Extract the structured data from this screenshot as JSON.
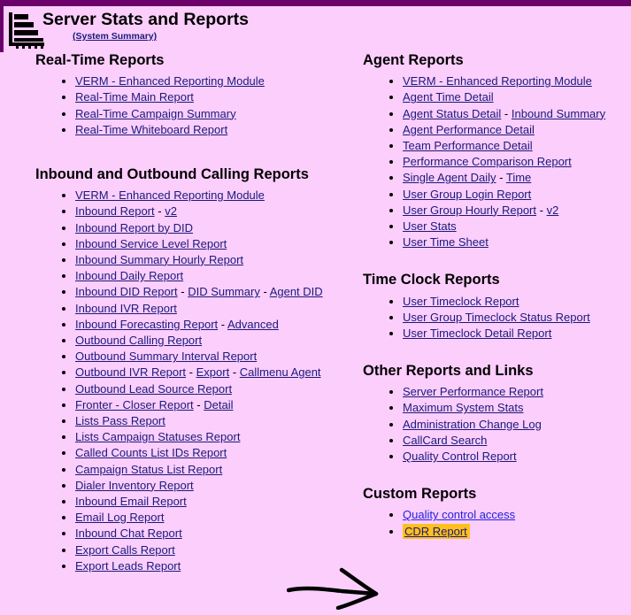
{
  "theme": {
    "page_bg": "#FCCEFC",
    "accent_bar": "#6B006B",
    "link_visited": "#1A1A7A",
    "link_unvisited": "#2222DD",
    "highlight": "#FFC01F",
    "text": "#000000"
  },
  "header": {
    "title": "Server Stats and Reports",
    "subtitle": "(System Summary)",
    "logo_icon": "bar-chart-icon"
  },
  "left_column": [
    {
      "heading": "Real-Time Reports",
      "items": [
        {
          "links": [
            {
              "label": "VERM - Enhanced Reporting Module",
              "state": "visited"
            }
          ]
        },
        {
          "links": [
            {
              "label": "Real-Time Main Report",
              "state": "visited"
            }
          ]
        },
        {
          "links": [
            {
              "label": "Real-Time Campaign Summary",
              "state": "visited"
            }
          ]
        },
        {
          "links": [
            {
              "label": "Real-Time Whiteboard Report",
              "state": "visited"
            }
          ]
        }
      ]
    },
    {
      "heading": "Inbound and Outbound Calling Reports",
      "items": [
        {
          "links": [
            {
              "label": "VERM - Enhanced Reporting Module",
              "state": "visited"
            }
          ]
        },
        {
          "links": [
            {
              "label": "Inbound Report",
              "state": "visited"
            },
            {
              "label": "v2",
              "state": "visited"
            }
          ]
        },
        {
          "links": [
            {
              "label": "Inbound Report by DID",
              "state": "visited"
            }
          ]
        },
        {
          "links": [
            {
              "label": "Inbound Service Level Report",
              "state": "visited"
            }
          ]
        },
        {
          "links": [
            {
              "label": "Inbound Summary Hourly Report",
              "state": "visited"
            }
          ]
        },
        {
          "links": [
            {
              "label": "Inbound Daily Report",
              "state": "visited"
            }
          ]
        },
        {
          "links": [
            {
              "label": "Inbound DID Report",
              "state": "visited"
            },
            {
              "label": "DID Summary",
              "state": "visited"
            },
            {
              "label": "Agent DID",
              "state": "visited"
            }
          ]
        },
        {
          "links": [
            {
              "label": "Inbound IVR Report",
              "state": "visited"
            }
          ]
        },
        {
          "links": [
            {
              "label": "Inbound Forecasting Report",
              "state": "visited"
            },
            {
              "label": "Advanced",
              "state": "visited"
            }
          ]
        },
        {
          "links": [
            {
              "label": "Outbound Calling Report",
              "state": "visited"
            }
          ]
        },
        {
          "links": [
            {
              "label": "Outbound Summary Interval Report",
              "state": "visited"
            }
          ]
        },
        {
          "links": [
            {
              "label": "Outbound IVR Report",
              "state": "visited"
            },
            {
              "label": "Export",
              "state": "visited"
            },
            {
              "label": "Callmenu Agent",
              "state": "visited"
            }
          ]
        },
        {
          "links": [
            {
              "label": "Outbound Lead Source Report",
              "state": "visited"
            }
          ]
        },
        {
          "links": [
            {
              "label": "Fronter - Closer Report",
              "state": "visited"
            },
            {
              "label": "Detail",
              "state": "visited"
            }
          ]
        },
        {
          "links": [
            {
              "label": "Lists Pass Report",
              "state": "visited"
            }
          ]
        },
        {
          "links": [
            {
              "label": "Lists Campaign Statuses Report",
              "state": "visited"
            }
          ]
        },
        {
          "links": [
            {
              "label": "Called Counts List IDs Report",
              "state": "visited"
            }
          ]
        },
        {
          "links": [
            {
              "label": "Campaign Status List Report",
              "state": "visited"
            }
          ]
        },
        {
          "links": [
            {
              "label": "Dialer Inventory Report",
              "state": "visited"
            }
          ]
        },
        {
          "links": [
            {
              "label": "Inbound Email Report",
              "state": "visited"
            }
          ]
        },
        {
          "links": [
            {
              "label": "Email Log Report",
              "state": "visited"
            }
          ]
        },
        {
          "links": [
            {
              "label": "Inbound Chat Report",
              "state": "visited"
            }
          ]
        },
        {
          "links": [
            {
              "label": "Export Calls Report",
              "state": "visited"
            }
          ]
        },
        {
          "links": [
            {
              "label": "Export Leads Report",
              "state": "visited"
            }
          ]
        }
      ]
    }
  ],
  "right_column": [
    {
      "heading": "Agent Reports",
      "items": [
        {
          "links": [
            {
              "label": "VERM - Enhanced Reporting Module",
              "state": "visited"
            }
          ]
        },
        {
          "links": [
            {
              "label": "Agent Time Detail",
              "state": "visited"
            }
          ]
        },
        {
          "links": [
            {
              "label": "Agent Status Detail",
              "state": "visited"
            },
            {
              "label": "Inbound Summary",
              "state": "visited"
            }
          ]
        },
        {
          "links": [
            {
              "label": "Agent Performance Detail",
              "state": "visited"
            }
          ]
        },
        {
          "links": [
            {
              "label": "Team Performance Detail",
              "state": "visited"
            }
          ]
        },
        {
          "links": [
            {
              "label": "Performance Comparison Report",
              "state": "visited"
            }
          ]
        },
        {
          "links": [
            {
              "label": "Single Agent Daily",
              "state": "visited"
            },
            {
              "label": "Time",
              "state": "visited"
            }
          ]
        },
        {
          "links": [
            {
              "label": "User Group Login Report",
              "state": "visited"
            }
          ]
        },
        {
          "links": [
            {
              "label": "User Group Hourly Report",
              "state": "visited"
            },
            {
              "label": "v2",
              "state": "visited"
            }
          ]
        },
        {
          "links": [
            {
              "label": "User Stats",
              "state": "visited"
            }
          ]
        },
        {
          "links": [
            {
              "label": "User Time Sheet",
              "state": "visited"
            }
          ]
        }
      ]
    },
    {
      "heading": "Time Clock Reports",
      "items": [
        {
          "links": [
            {
              "label": "User Timeclock Report",
              "state": "visited"
            }
          ]
        },
        {
          "links": [
            {
              "label": "User Group Timeclock Status Report",
              "state": "visited"
            }
          ]
        },
        {
          "links": [
            {
              "label": "User Timeclock Detail Report",
              "state": "visited"
            }
          ]
        }
      ]
    },
    {
      "heading": "Other Reports and Links",
      "items": [
        {
          "links": [
            {
              "label": "Server Performance Report",
              "state": "visited"
            }
          ]
        },
        {
          "links": [
            {
              "label": "Maximum System Stats",
              "state": "visited"
            }
          ]
        },
        {
          "links": [
            {
              "label": "Administration Change Log",
              "state": "visited"
            }
          ]
        },
        {
          "links": [
            {
              "label": "CallCard Search",
              "state": "visited"
            }
          ]
        },
        {
          "links": [
            {
              "label": "Quality Control Report",
              "state": "visited"
            }
          ]
        }
      ]
    },
    {
      "heading": "Custom Reports",
      "items": [
        {
          "links": [
            {
              "label": "Quality control access",
              "state": "unvisited"
            }
          ]
        },
        {
          "links": [
            {
              "label": "CDR Report",
              "state": "visited",
              "highlighted": true
            }
          ]
        }
      ]
    }
  ],
  "annotation": {
    "arrow_icon": "hand-drawn-arrow-icon",
    "points_to": "CDR Report",
    "color": "#000000"
  },
  "separator": "-"
}
